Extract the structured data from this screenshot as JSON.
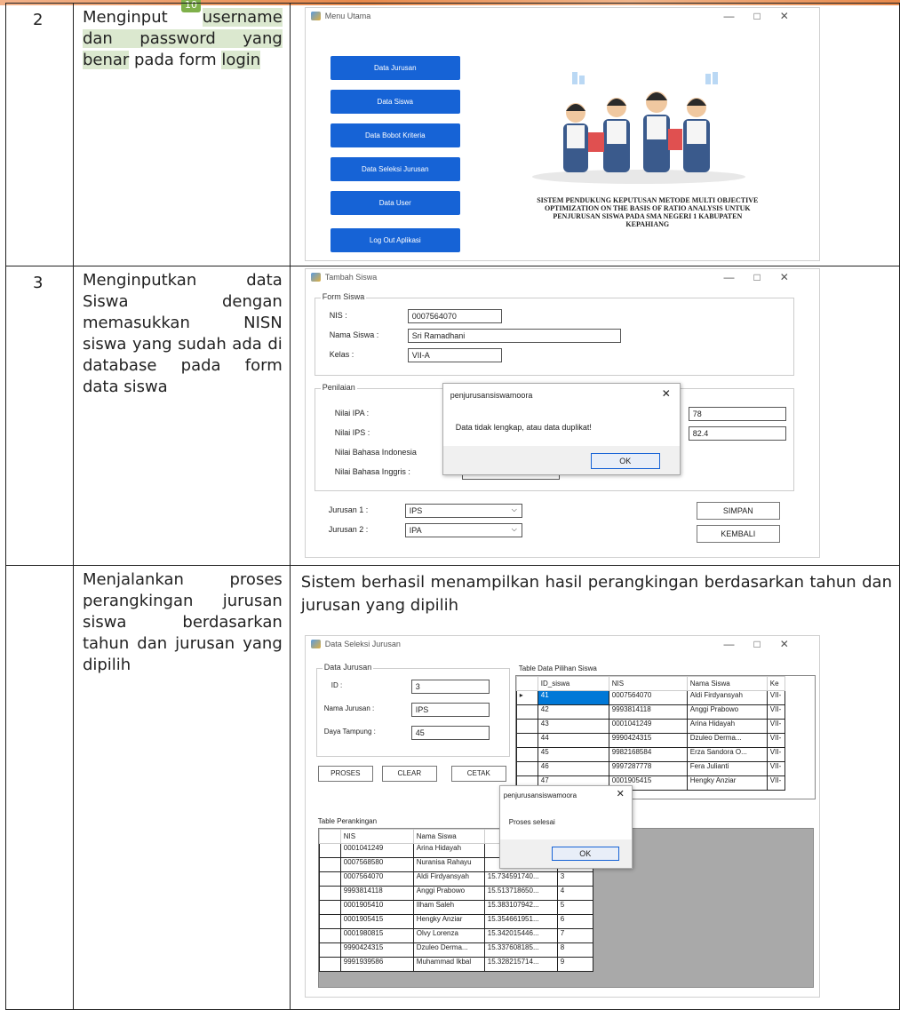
{
  "page_number": "10",
  "rows": [
    {
      "no": "2",
      "step_parts": [
        {
          "text": "Menginput ",
          "hl": false
        },
        {
          "text": "username dan password yang benar",
          "hl": true
        },
        {
          "text": " pada form ",
          "hl": false
        },
        {
          "text": "login",
          "hl": true
        }
      ]
    },
    {
      "no": "3",
      "step": "Menginputkan data Siswa dengan memasukkan NISN siswa yang sudah ada di database pada form data siswa"
    },
    {
      "no": "",
      "step": "Menjalankan proses perangkingan jurusan siswa berdasarkan tahun dan jurusan yang dipilih",
      "result": "Sistem berhasil menampilkan hasil perangkingan berdasarkan tahun dan jurusan yang dipilih"
    }
  ],
  "menu_window": {
    "title": "Menu Utama",
    "buttons": [
      "Data Jurusan",
      "Data Siswa",
      "Data Bobot Kriteria",
      "Data Seleksi Jurusan",
      "Data User",
      "Log Out Aplikasi"
    ],
    "caption": "SISTEM PENDUKUNG KEPUTUSAN METODE MULTI OBJECTIVE OPTIMIZATION ON THE BASIS OF RATIO ANALYSIS UNTUK PENJURUSAN SISWA PADA SMA NEGERI 1 KABUPATEN KEPAHIANG"
  },
  "siswa_window": {
    "title": "Tambah Siswa",
    "form_group": "Form Siswa",
    "nis_label": "NIS :",
    "nis_value": "0007564070",
    "nama_label": "Nama Siswa :",
    "nama_value": "Sri Ramadhani",
    "kelas_label": "Kelas :",
    "kelas_value": "VII-A",
    "penilaian_group": "Penilaian",
    "ipa_label": "Nilai IPA :",
    "ips_label": "Nilai IPS :",
    "bindo_label": "Nilai Bahasa Indonesia",
    "bing_label": "Nilai Bahasa Inggris :",
    "val1": "78",
    "val2": "82.4",
    "jurusan1_label": "Jurusan 1 :",
    "jurusan1_value": "IPS",
    "jurusan2_label": "Jurusan 2 :",
    "jurusan2_value": "IPA",
    "simpan": "SIMPAN",
    "kembali": "KEMBALI",
    "dialog_title": "penjurusansiswamoora",
    "dialog_msg": "Data tidak lengkap, atau data duplikat!",
    "dialog_ok": "OK"
  },
  "seleksi_window": {
    "title": "Data Seleksi Jurusan",
    "jurusan_group": "Data Jurusan",
    "id_label": "ID :",
    "id_value": "3",
    "nama_label": "Nama Jurusan :",
    "nama_value": "IPS",
    "daya_label": "Daya Tampung :",
    "daya_value": "45",
    "proses": "PROSES",
    "clear": "CLEAR",
    "cetak": "CETAK",
    "pilihan_group": "Table Data Pilihan Siswa",
    "pilihan_headers": [
      "ID_siswa",
      "NIS",
      "Nama Siswa",
      "Ke"
    ],
    "pilihan_rows": [
      [
        "41",
        "0007564070",
        "Aldi Firdyansyah",
        "VII-"
      ],
      [
        "42",
        "9993814118",
        "Anggi Prabowo",
        "VII-"
      ],
      [
        "43",
        "0001041249",
        "Arina Hidayah",
        "VII-"
      ],
      [
        "44",
        "9990424315",
        "Dzuleo Derma...",
        "VII-"
      ],
      [
        "45",
        "9982168584",
        "Erza Sandora O...",
        "VII-"
      ],
      [
        "46",
        "9997287778",
        "Fera Julianti",
        "VII-"
      ],
      [
        "47",
        "0001905415",
        "Hengky Anziar",
        "VII-"
      ]
    ],
    "rank_group": "Table Perankingan",
    "rank_headers": [
      "NIS",
      "Nama Siswa",
      "",
      ""
    ],
    "rank_rows": [
      [
        "0001041249",
        "Arina Hidayah",
        "",
        ""
      ],
      [
        "0007568580",
        "Nuranisa Rahayu",
        "",
        ""
      ],
      [
        "0007564070",
        "Aldi Firdyansyah",
        "15.734591740...",
        "3"
      ],
      [
        "9993814118",
        "Anggi Prabowo",
        "15.513718650...",
        "4"
      ],
      [
        "0001905410",
        "Ilham Saleh",
        "15.383107942...",
        "5"
      ],
      [
        "0001905415",
        "Hengky Anziar",
        "15.354661951...",
        "6"
      ],
      [
        "0001980815",
        "Olvy Lorenza",
        "15.342015446...",
        "7"
      ],
      [
        "9990424315",
        "Dzuleo Derma...",
        "15.337608185...",
        "8"
      ],
      [
        "9991939586",
        "Muhammad Ikbal",
        "15.328215714...",
        "9"
      ]
    ],
    "dialog_title": "penjurusansiswamoora",
    "dialog_msg": "Proses selesai",
    "dialog_ok": "OK"
  }
}
